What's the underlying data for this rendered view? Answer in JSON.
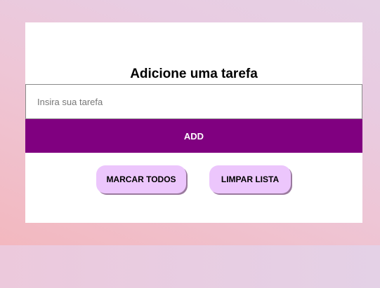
{
  "form": {
    "title": "Adicione uma tarefa",
    "input_placeholder": "Insira sua tarefa",
    "input_value": "",
    "add_label": "ADD"
  },
  "actions": {
    "mark_all_label": "MARCAR TODOS",
    "clear_list_label": "LIMPAR LISTA"
  },
  "colors": {
    "add_button": "#800080",
    "action_button": "#ecc6fc",
    "card": "#ffffff"
  }
}
